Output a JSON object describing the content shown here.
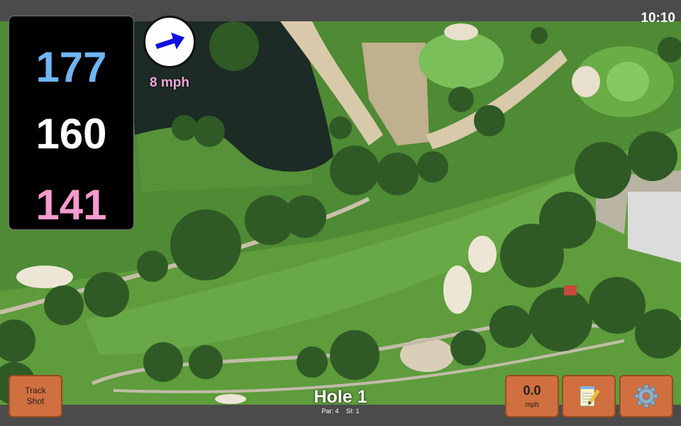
{
  "status_bar": {
    "time": "10:10"
  },
  "distances": {
    "back": "177",
    "center": "160",
    "front": "141"
  },
  "wind": {
    "speed": "8 mph",
    "arrow_color": "#1010e0"
  },
  "buttons": {
    "track_shot_line1": "Track",
    "track_shot_line2": "Shot",
    "shot_speed_value": "0.0",
    "shot_speed_unit": "mph",
    "notes_icon": "notepad-icon",
    "settings_icon": "gear-icon"
  },
  "hole": {
    "title": "Hole 1",
    "par": "Par: 4",
    "si": "SI: 1"
  },
  "colors": {
    "button": "#d06f3f",
    "back_distance": "#6fb5f3",
    "front_distance": "#f59bcd",
    "wind_speed": "#f2a6da"
  }
}
